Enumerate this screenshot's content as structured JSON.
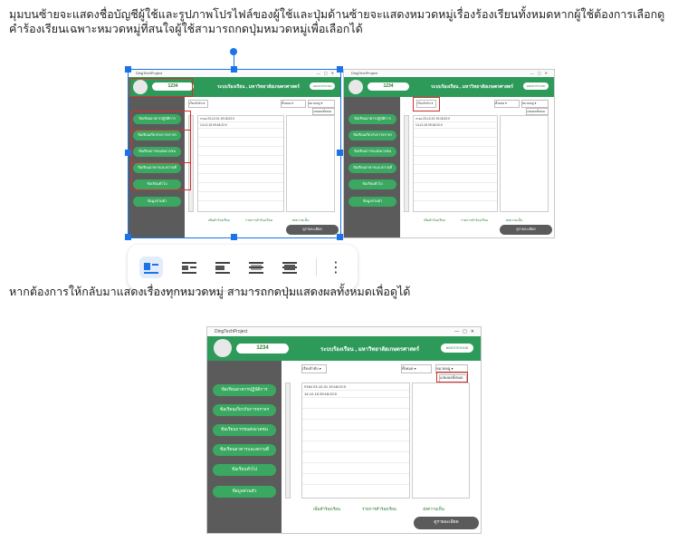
{
  "text": {
    "p1": "มุมบนซ้ายจะแสดงชื่อบัญชีผู้ใช้และรูปภาพโปรไฟล์ของผู้ใช้และปุ่มด้านซ้ายจะแสดงหมวดหมู่เรื่องร้องเรียนทั้งหมดหากผู้ใช้ต้องการเลือกดูคำร้องเรียนเฉพาะหมวดหมู่ที่สนใจผู้ใช้สามารถกดปุ่มหมวดหมู่เพื่อเลือกได้",
    "p2": "หากต้องการให้กลับมาแสดงเรื่องทุกหมวดหมู่ สามารถกดปุ่มแสดงผลทั้งหมดเพื่อดูได้"
  },
  "app": {
    "window_title": "DingTechProject",
    "window_controls": "—▢✕",
    "user_id": "1234",
    "header_title": "ระบบร้องเรียน , มหาวิทยาลัยเกษตรศาสตร์",
    "logout": "ออกจากระบบ",
    "categories": [
      "ข้อเรียนอาคารปฏิบัติการ",
      "ข้อเรียนเกี่ยวกับการจราจร",
      "ข้อเรียนการขนส่งมวลชน",
      "ข้อเรียนอาคารและสถานที่",
      "ข้อเรียนทั่วไป",
      "ข้อมูลส่วนตัว"
    ],
    "sort_dropdown": "เรียงลำดับ ▾",
    "filter_dropdown": "ทั้งหมด ▾",
    "category_dropdown": "หมวดหมู่ ▾",
    "show_all": "แสดงผลทั้งหมด",
    "list_rows": [
      "กรอง 23-12-01 19:18:22:0",
      "14-12-15 09:18:22:0"
    ],
    "footer_buttons": [
      "เพิ่มคำร้องเรียน",
      "รายการคำร้องเรียน",
      "ส่งความเห็น"
    ],
    "status": "ดูรายละเอียด"
  },
  "icons": {
    "toolbar": [
      "wrap-inline-icon",
      "wrap-square-icon",
      "wrap-top-bottom-icon",
      "wrap-behind-icon",
      "wrap-front-icon",
      "more-options-icon"
    ],
    "more": "⋮"
  },
  "colors": {
    "accent": "#2e9a5a",
    "sidebar": "#5b5b5b",
    "highlight": "#d32f2f",
    "selection": "#1a73e8"
  }
}
